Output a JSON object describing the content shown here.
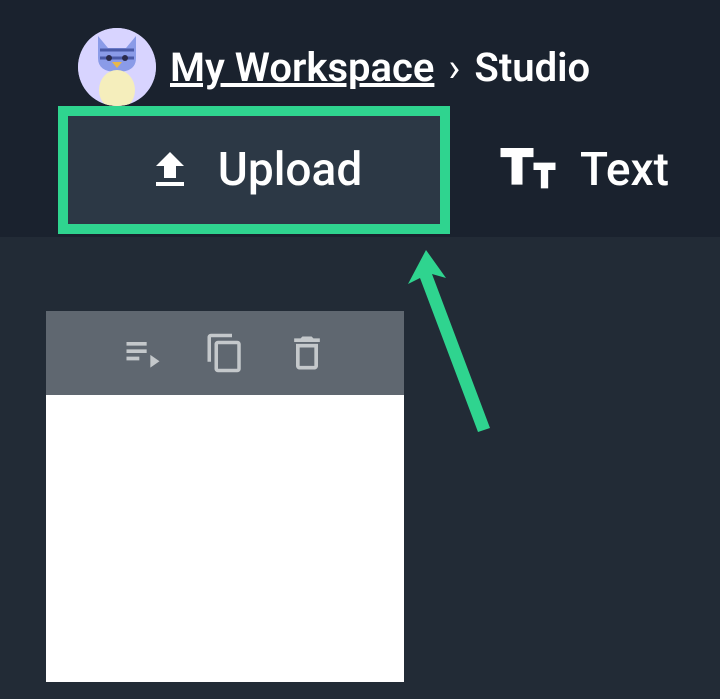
{
  "breadcrumb": {
    "workspace": "My Workspace",
    "separator": "›",
    "current": "Studio"
  },
  "tabs": {
    "upload": "Upload",
    "text": "Text"
  },
  "colors": {
    "highlight": "#2fd48f"
  }
}
